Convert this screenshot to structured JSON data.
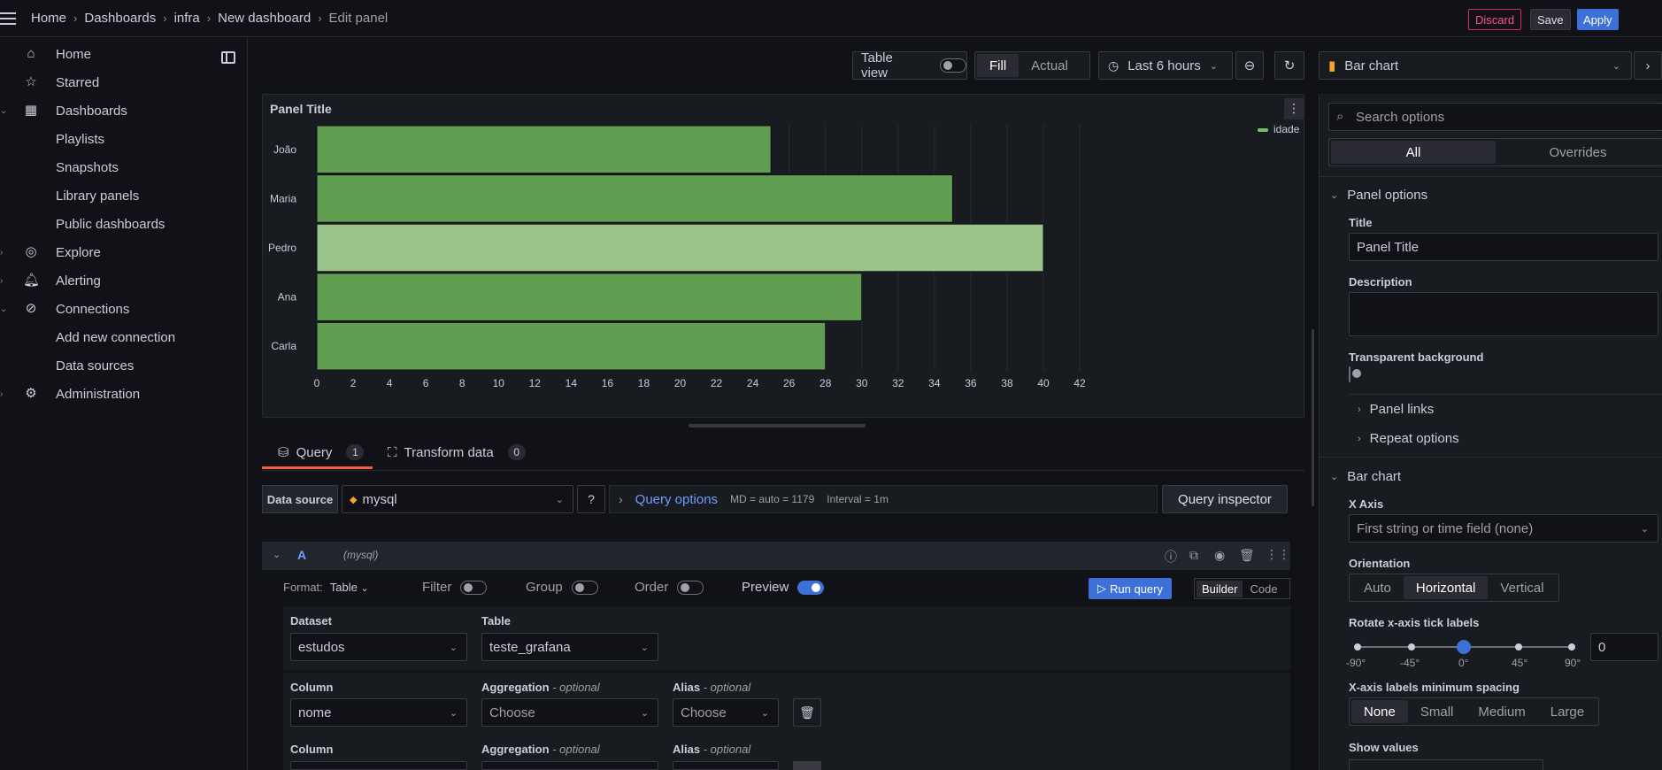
{
  "breadcrumb": [
    "Home",
    "Dashboards",
    "infra",
    "New dashboard",
    "Edit panel"
  ],
  "topbar": {
    "discard": "Discard",
    "save": "Save",
    "apply": "Apply"
  },
  "sidebar": {
    "items": [
      {
        "label": "Home",
        "icon": "home-icon"
      },
      {
        "label": "Starred",
        "icon": "star-icon"
      },
      {
        "label": "Dashboards",
        "icon": "dashboards-icon"
      },
      {
        "label": "Playlists"
      },
      {
        "label": "Snapshots"
      },
      {
        "label": "Library panels"
      },
      {
        "label": "Public dashboards"
      },
      {
        "label": "Explore",
        "icon": "compass-icon"
      },
      {
        "label": "Alerting",
        "icon": "bell-icon"
      },
      {
        "label": "Connections",
        "icon": "connections-icon"
      },
      {
        "label": "Add new connection"
      },
      {
        "label": "Data sources"
      },
      {
        "label": "Administration",
        "icon": "gear-icon"
      }
    ]
  },
  "toolbar": {
    "table_view": "Table view",
    "fill": "Fill",
    "actual": "Actual",
    "time_range": "Last 6 hours",
    "viz_type": "Bar chart"
  },
  "panel": {
    "title": "Panel Title",
    "scrollbar": ""
  },
  "chart_data": {
    "type": "bar",
    "orientation": "horizontal",
    "categories": [
      "João",
      "Maria",
      "Pedro",
      "Ana",
      "Carla"
    ],
    "series": [
      {
        "name": "idade",
        "values": [
          25,
          35,
          40,
          30,
          28
        ]
      }
    ],
    "xticks": [
      "0",
      "2",
      "4",
      "6",
      "8",
      "10",
      "12",
      "14",
      "16",
      "18",
      "20",
      "22",
      "24",
      "26",
      "28",
      "30",
      "32",
      "34",
      "36",
      "38",
      "40",
      "42"
    ],
    "xlim": [
      0,
      42
    ],
    "highlighted": "Pedro",
    "legend": "top-right",
    "colors": {
      "bar": "#629e51",
      "highlight": "#9ac48a",
      "edge": "#73bf69"
    }
  },
  "tabs": {
    "query": "Query",
    "query_count": "1",
    "transform": "Transform data",
    "transform_count": "0"
  },
  "query": {
    "datasource_label": "Data source",
    "datasource": "mysql",
    "query_options": "Query options",
    "md": "MD = auto = 1179",
    "interval": "Interval = 1m",
    "inspector": "Query inspector",
    "ref": "A",
    "ref_ds": "(mysql)",
    "format_label": "Format:",
    "format_value": "Table",
    "filter": "Filter",
    "group": "Group",
    "order": "Order",
    "preview": "Preview",
    "run": "Run query",
    "builder": "Builder",
    "code": "Code",
    "dataset_label": "Dataset",
    "dataset": "estudos",
    "table_label": "Table",
    "table": "teste_grafana",
    "column_label": "Column",
    "column": "nome",
    "aggregation_label": "Aggregation",
    "optional": "- optional",
    "choose": "Choose",
    "alias_label": "Alias"
  },
  "options": {
    "search_placeholder": "Search options",
    "all": "All",
    "overrides": "Overrides",
    "panel_options": "Panel options",
    "title_label": "Title",
    "title_value": "Panel Title",
    "description_label": "Description",
    "transparent_label": "Transparent background",
    "panel_links": "Panel links",
    "repeat_options": "Repeat options",
    "bar_chart": "Bar chart",
    "x_axis_label": "X Axis",
    "x_axis_value": "First string or time field (none)",
    "orientation_label": "Orientation",
    "orientation": [
      "Auto",
      "Horizontal",
      "Vertical"
    ],
    "rotate_label": "Rotate x-axis tick labels",
    "rotate_ticks": [
      "-90°",
      "-45°",
      "0°",
      "45°",
      "90°"
    ],
    "rotate_value": "0",
    "spacing_label": "X-axis labels minimum spacing",
    "spacing": [
      "None",
      "Small",
      "Medium",
      "Large"
    ],
    "show_values_label": "Show values"
  }
}
